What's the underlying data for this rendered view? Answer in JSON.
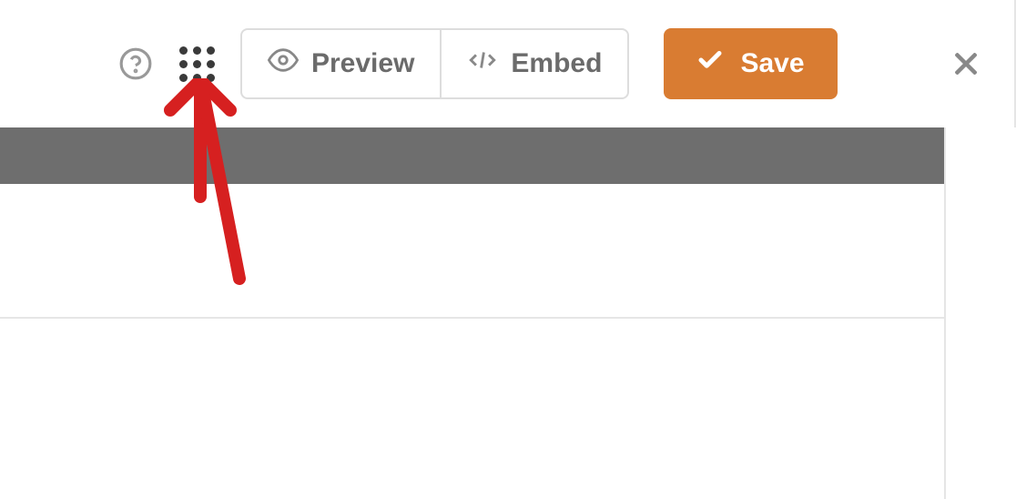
{
  "toolbar": {
    "preview_label": "Preview",
    "embed_label": "Embed",
    "save_label": "Save"
  },
  "colors": {
    "accent": "#d97c32",
    "muted_text": "#6b6b6b",
    "border": "#ddd",
    "annotation": "#d62020"
  }
}
